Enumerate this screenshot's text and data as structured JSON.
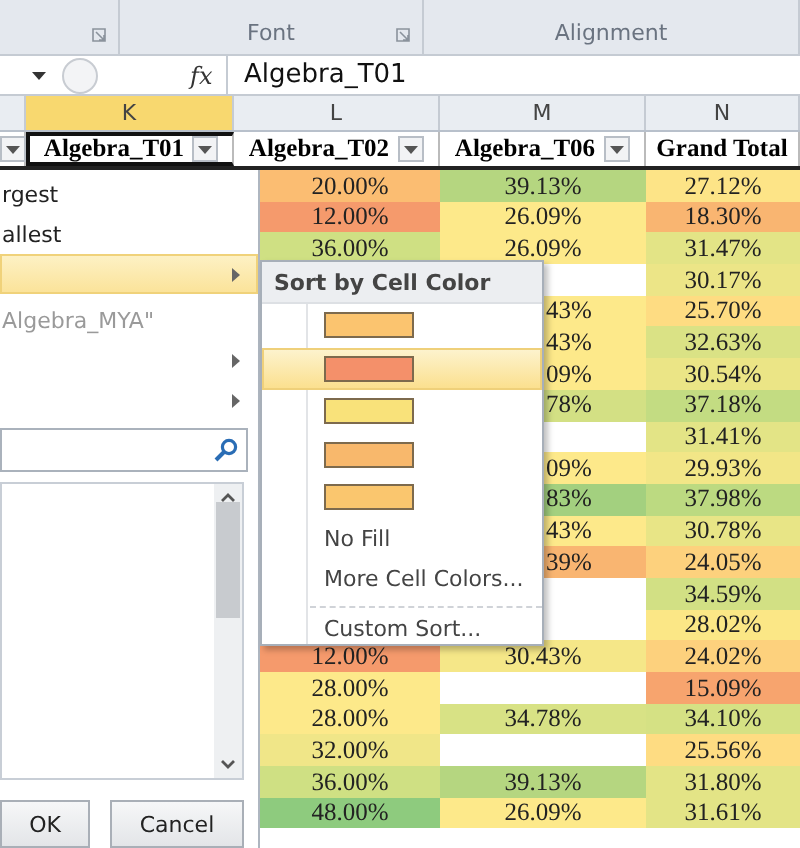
{
  "ribbon": {
    "groups": [
      {
        "label": "Font"
      },
      {
        "label": "Alignment"
      }
    ]
  },
  "formula_bar": {
    "fx": "fx",
    "value": "Algebra_T01"
  },
  "columns": [
    {
      "letter": "K",
      "field": "Algebra_T01",
      "selected": true
    },
    {
      "letter": "L",
      "field": "Algebra_T02",
      "selected": false
    },
    {
      "letter": "M",
      "field": "Algebra_T06",
      "selected": false
    },
    {
      "letter": "N",
      "field": "Grand Total",
      "selected": false
    }
  ],
  "rows": [
    [
      {
        "text": "20.00%",
        "color": "#fbbd72"
      },
      {
        "text": "39.13%",
        "color": "#b5d680"
      },
      {
        "text": "27.12%",
        "color": "#fde487"
      }
    ],
    [
      {
        "text": "12.00%",
        "color": "#f59a6c"
      },
      {
        "text": "26.09%",
        "color": "#fde98a"
      },
      {
        "text": "18.30%",
        "color": "#f9b571"
      }
    ],
    [
      {
        "text": "36.00%",
        "color": "#cfe083"
      },
      {
        "text": "26.09%",
        "color": "#fde98a"
      },
      {
        "text": "31.47%",
        "color": "#e3e486"
      }
    ],
    [
      null,
      null,
      {
        "text": "30.17%",
        "color": "#ece587"
      }
    ],
    [
      null,
      {
        "text": "43%",
        "color": "#fde98a",
        "clipped": true
      },
      {
        "text": "25.70%",
        "color": "#fedc82"
      }
    ],
    [
      null,
      {
        "text": "43%",
        "color": "#fde98a",
        "clipped": true
      },
      {
        "text": "32.63%",
        "color": "#dae285"
      }
    ],
    [
      null,
      {
        "text": "09%",
        "color": "#fde98a",
        "clipped": true
      },
      {
        "text": "30.54%",
        "color": "#ebe586"
      }
    ],
    [
      null,
      {
        "text": "78%",
        "color": "#d3e084",
        "clipped": true
      },
      {
        "text": "37.18%",
        "color": "#c3dc82"
      }
    ],
    [
      null,
      null,
      {
        "text": "31.41%",
        "color": "#e3e486"
      }
    ],
    [
      null,
      {
        "text": "09%",
        "color": "#fde98a",
        "clipped": true
      },
      {
        "text": "29.93%",
        "color": "#f2e687"
      }
    ],
    [
      null,
      {
        "text": "83%",
        "color": "#a3d07f",
        "clipped": true
      },
      {
        "text": "37.98%",
        "color": "#bcda81"
      }
    ],
    [
      null,
      {
        "text": "43%",
        "color": "#fde98a",
        "clipped": true
      },
      {
        "text": "30.78%",
        "color": "#e8e586"
      }
    ],
    [
      null,
      {
        "text": "39%",
        "color": "#f9b571",
        "clipped": true
      },
      {
        "text": "24.05%",
        "color": "#fdd17d"
      }
    ],
    [
      null,
      null,
      {
        "text": "34.59%",
        "color": "#d2e084"
      }
    ],
    [
      null,
      null,
      {
        "text": "28.02%",
        "color": "#fbe786"
      }
    ],
    [
      {
        "text": "12.00%",
        "color": "#f59a6c"
      },
      {
        "text": "30.43%",
        "color": "#f5e788"
      },
      {
        "text": "24.02%",
        "color": "#fdd17d"
      }
    ],
    [
      {
        "text": "28.00%",
        "color": "#fde98a"
      },
      null,
      {
        "text": "15.09%",
        "color": "#f7a46e"
      }
    ],
    [
      {
        "text": "28.00%",
        "color": "#fde98a"
      },
      {
        "text": "34.78%",
        "color": "#d8e285"
      },
      {
        "text": "34.10%",
        "color": "#d5e184"
      }
    ],
    [
      {
        "text": "32.00%",
        "color": "#f0e688"
      },
      null,
      {
        "text": "25.56%",
        "color": "#fedc82"
      }
    ],
    [
      {
        "text": "36.00%",
        "color": "#cfe083"
      },
      {
        "text": "39.13%",
        "color": "#b5d680"
      },
      {
        "text": "31.80%",
        "color": "#e3e486"
      }
    ],
    [
      {
        "text": "48.00%",
        "color": "#8ecb7e"
      },
      {
        "text": "26.09%",
        "color": "#fde98a"
      },
      {
        "text": "31.61%",
        "color": "#e3e486"
      }
    ]
  ],
  "filter_panel": {
    "items": [
      {
        "text": "rgest",
        "arrow": false,
        "highlighted": false,
        "disabled": false
      },
      {
        "text": "allest",
        "arrow": false,
        "highlighted": false,
        "disabled": false
      },
      {
        "arrow": true,
        "highlighted": true,
        "disabled": false
      },
      {
        "text": "Algebra_MYA\"",
        "arrow": false,
        "highlighted": false,
        "disabled": true
      },
      {
        "arrow": true,
        "highlighted": false,
        "disabled": false
      },
      {
        "arrow": true,
        "highlighted": false,
        "disabled": false
      }
    ],
    "buttons": [
      "OK",
      "Cancel"
    ]
  },
  "color_menu": {
    "title": "Sort by Cell Color",
    "swatches": [
      {
        "color": "#fbc46f",
        "selected": false
      },
      {
        "color": "#f4906a",
        "selected": true
      },
      {
        "color": "#f9e27a",
        "selected": false
      },
      {
        "color": "#f8b86c",
        "selected": false
      },
      {
        "color": "#fac66e",
        "selected": false
      }
    ],
    "items": [
      {
        "label": "No Fill"
      },
      {
        "label": "More Cell Colors..."
      }
    ],
    "footer_items": [
      {
        "label": "Custom Sort..."
      }
    ]
  }
}
